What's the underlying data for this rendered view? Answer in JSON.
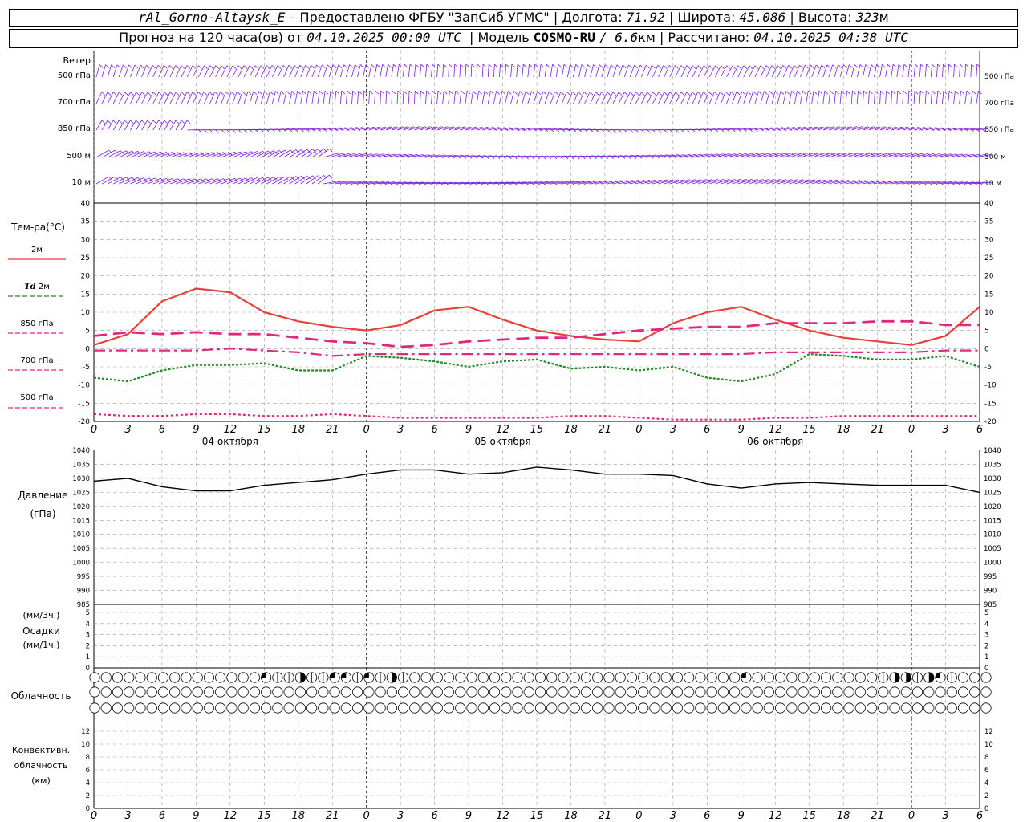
{
  "header": {
    "station": "rAl_Gorno-Altaysk_E",
    "dash": "–",
    "provider": "Предоставлено ФГБУ \"ЗапСиб УГМС\"",
    "lon_label": "Долгота:",
    "lon": "71.92",
    "lat_label": "Широта:",
    "lat": "45.086",
    "alt_label": "Высота:",
    "alt": "323",
    "alt_unit": "м",
    "forecast_label": "Прогноз на 120 часа(ов) от",
    "forecast_start": "04.10.2025 00:00 UTC",
    "model_label": "Модель",
    "model": "COSMO-RU",
    "resolution": "/ 6.6",
    "resolution_unit": "км",
    "calc_label": "Рассчитано:",
    "calc_time": "04.10.2025 04:38 UTC",
    "sep": "|"
  },
  "labels": {
    "wind_title": "Ветер",
    "wind_levels": [
      "500 гПа",
      "700 гПа",
      "850 гПа",
      "500 м",
      "10 м"
    ],
    "temp_title": "Тем-ра(°С)",
    "t2m": "2м",
    "td_sym": "Td",
    "td2m": "2м",
    "t850": "850 гПа",
    "t700": "700 гПа",
    "t500": "500 гПа",
    "pressure_title": "Давление",
    "pressure_unit": "(гПа)",
    "precip_unit1": "(мм/3ч.)",
    "precip_title": "Осадки",
    "precip_unit2": "(мм/1ч.)",
    "cloud_title": "Облачность",
    "conv_title1": "Конвективн.",
    "conv_title2": "облачность",
    "conv_unit": "(км)",
    "days": [
      "04 октября",
      "05 октября",
      "06 октября"
    ]
  },
  "colors": {
    "t2m": "#e8403a",
    "td": "#228b22",
    "t850": "#e0287f",
    "t700": "#e0287f",
    "t500": "#e0287f",
    "wind": "#7a1fd6",
    "pressure": "#000000",
    "grid": "#9a9a9a"
  },
  "chart_data": [
    {
      "type": "wind-barbs",
      "title": "Ветер",
      "levels": [
        "500 гПа",
        "700 гПа",
        "850 гПа",
        "500 м",
        "10 м"
      ],
      "x_hours_range": [
        0,
        78
      ],
      "x_ticks": [
        "0",
        "3",
        "6",
        "9",
        "12",
        "15",
        "18",
        "21",
        "0",
        "3",
        "6",
        "9",
        "12",
        "15",
        "18",
        "21",
        "0",
        "3",
        "6",
        "9",
        "12",
        "15",
        "18",
        "21",
        "0",
        "3",
        "6"
      ]
    },
    {
      "type": "line",
      "title": "Тем-ра(°С)",
      "ylim": [
        -20,
        40
      ],
      "yticks": [
        -20,
        -15,
        -10,
        -5,
        0,
        5,
        10,
        15,
        20,
        25,
        30,
        35,
        40
      ],
      "x_ticks": [
        "0",
        "3",
        "6",
        "9",
        "12",
        "15",
        "18",
        "21",
        "0",
        "3",
        "6",
        "9",
        "12",
        "15",
        "18",
        "21",
        "0",
        "3",
        "6",
        "9",
        "12",
        "15",
        "18",
        "21",
        "0",
        "3",
        "6"
      ],
      "x_hours": [
        0,
        3,
        6,
        9,
        12,
        15,
        18,
        21,
        24,
        27,
        30,
        33,
        36,
        39,
        42,
        45,
        48,
        51,
        54,
        57,
        60,
        63,
        66,
        69,
        72,
        75,
        78
      ],
      "series": [
        {
          "name": "2м",
          "key": "t2m",
          "values": [
            1,
            4,
            13,
            16.5,
            15.5,
            10,
            7.5,
            6,
            5,
            6.5,
            10.5,
            11.5,
            8,
            5,
            3.5,
            2.5,
            2,
            7,
            10,
            11.5,
            8,
            5,
            3,
            2,
            1,
            3.5,
            11.5
          ]
        },
        {
          "name": "Td 2м",
          "key": "td",
          "values": [
            -8,
            -9,
            -6,
            -4.5,
            -4.5,
            -4,
            -6,
            -6,
            -2,
            -2.5,
            -3.5,
            -5,
            -3.5,
            -3,
            -5.5,
            -5,
            -6,
            -5,
            -8,
            -9,
            -7,
            -1.5,
            -2,
            -3,
            -3,
            -2,
            -5
          ]
        },
        {
          "name": "850 гПа",
          "key": "t850",
          "values": [
            3.5,
            4.5,
            4,
            4.5,
            4,
            4,
            3,
            2,
            1.5,
            0.5,
            1,
            2,
            2.5,
            3,
            3,
            4,
            5,
            5.5,
            6,
            6,
            7,
            7,
            7,
            7.5,
            7.5,
            6.5,
            6.5
          ]
        },
        {
          "name": "700 гПа",
          "key": "t700",
          "values": [
            -0.5,
            -0.5,
            -0.5,
            -0.5,
            0,
            -0.5,
            -1,
            -2,
            -1.5,
            -1.5,
            -1.5,
            -1.5,
            -1.5,
            -1.5,
            -1.5,
            -1.5,
            -1.5,
            -1.5,
            -1.5,
            -1.5,
            -1,
            -1,
            -1,
            -1,
            -1,
            -0.5,
            -0.5
          ]
        },
        {
          "name": "500 гПа",
          "key": "t500",
          "values": [
            -18,
            -18.5,
            -18.5,
            -18,
            -18,
            -18.5,
            -18.5,
            -18,
            -18.5,
            -19,
            -19,
            -19,
            -19,
            -19,
            -18.5,
            -18.5,
            -19,
            -19.5,
            -19.5,
            -19.5,
            -19,
            -19,
            -18.5,
            -18.5,
            -18.5,
            -18.5,
            -18.5
          ]
        }
      ]
    },
    {
      "type": "line",
      "title": "Давление",
      "ylabel": "(гПа)",
      "ylim": [
        985,
        1040
      ],
      "yticks": [
        985,
        990,
        995,
        1000,
        1005,
        1010,
        1015,
        1020,
        1025,
        1030,
        1035,
        1040
      ],
      "x_hours": [
        0,
        3,
        6,
        9,
        12,
        15,
        18,
        21,
        24,
        27,
        30,
        33,
        36,
        39,
        42,
        45,
        48,
        51,
        54,
        57,
        60,
        63,
        66,
        69,
        72,
        75,
        78
      ],
      "series": [
        {
          "name": "Давление",
          "key": "pressure",
          "values": [
            1029,
            1030,
            1027,
            1025.5,
            1025.5,
            1027.5,
            1028.5,
            1029.5,
            1031.5,
            1033,
            1033,
            1031.5,
            1032,
            1034,
            1033,
            1031.5,
            1031.5,
            1031,
            1028,
            1026.5,
            1028,
            1028.5,
            1028,
            1027.5,
            1027.5,
            1027.5,
            1025
          ]
        }
      ]
    },
    {
      "type": "bar",
      "title": "Осадки",
      "ylabel_3h": "(мм/3ч.)",
      "ylabel_1h": "(мм/1ч.)",
      "ylim": [
        0,
        5
      ],
      "yticks": [
        0,
        1,
        2,
        3,
        4,
        5
      ],
      "values": []
    },
    {
      "type": "table",
      "title": "Облачность",
      "rows": 3,
      "columns": 79,
      "description_values": "circles, mostly clear; partial symbols in top row near hours 15-27, 57 and 69-75"
    },
    {
      "type": "bar",
      "title": "Конвективн. облачность",
      "ylabel": "(км)",
      "ylim": [
        0,
        13
      ],
      "yticks": [
        0,
        2,
        4,
        6,
        8,
        10,
        12
      ],
      "values": []
    }
  ]
}
